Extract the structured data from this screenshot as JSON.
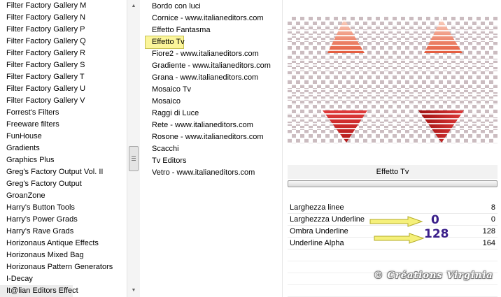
{
  "categories": [
    "Filter Factory Gallery M",
    "Filter Factory Gallery N",
    "Filter Factory Gallery P",
    "Filter Factory Gallery Q",
    "Filter Factory Gallery R",
    "Filter Factory Gallery S",
    "Filter Factory Gallery T",
    "Filter Factory Gallery U",
    "Filter Factory Gallery V",
    "Forrest's Filters",
    "Freeware filters",
    "FunHouse",
    "Gradients",
    "Graphics Plus",
    "Greg's Factory Output Vol. II",
    "Greg's Factory Output",
    "GroanZone",
    "Harry's Button Tools",
    "Harry's Power Grads",
    "Harry's Rave Grads",
    "Horizonaus Antique Effects",
    "Horizonaus Mixed Bag",
    "Horizonaus Pattern Generators",
    "I-Decay",
    "It@lian Editors Effect"
  ],
  "effects": [
    "Bordo con luci",
    "Cornice - www.italianeditors.com",
    "Effetto Fantasma",
    "Effetto Tv",
    "Fiore2 - www.italianeditors.com",
    "Gradiente - www.italianeditors.com",
    "Grana - www.italianeditors.com",
    "Mosaico Tv",
    "Mosaico",
    "Raggi di Luce",
    "Rete - www.italianeditors.com",
    "Rosone - www.italianeditors.com",
    "Scacchi",
    "Tv Editors",
    "Vetro - www.italianeditors.com"
  ],
  "effect_title": "Effetto Tv",
  "params": [
    {
      "name": "Larghezza linee",
      "value": "8"
    },
    {
      "name": "Larghezzza Underline",
      "value": "0"
    },
    {
      "name": "Ombra Underline",
      "value": "128"
    },
    {
      "name": "Underline Alpha",
      "value": "164"
    }
  ],
  "annotations": {
    "first": "0",
    "second": "128"
  },
  "watermark": "© Créations Virginia",
  "colors": {
    "selection": "#fbf59a",
    "annotation": "#3a1f8a",
    "arrow": "#f5f07a"
  },
  "icons": {
    "scroll_up": "arrow-up-icon",
    "scroll_down": "arrow-down-icon"
  }
}
